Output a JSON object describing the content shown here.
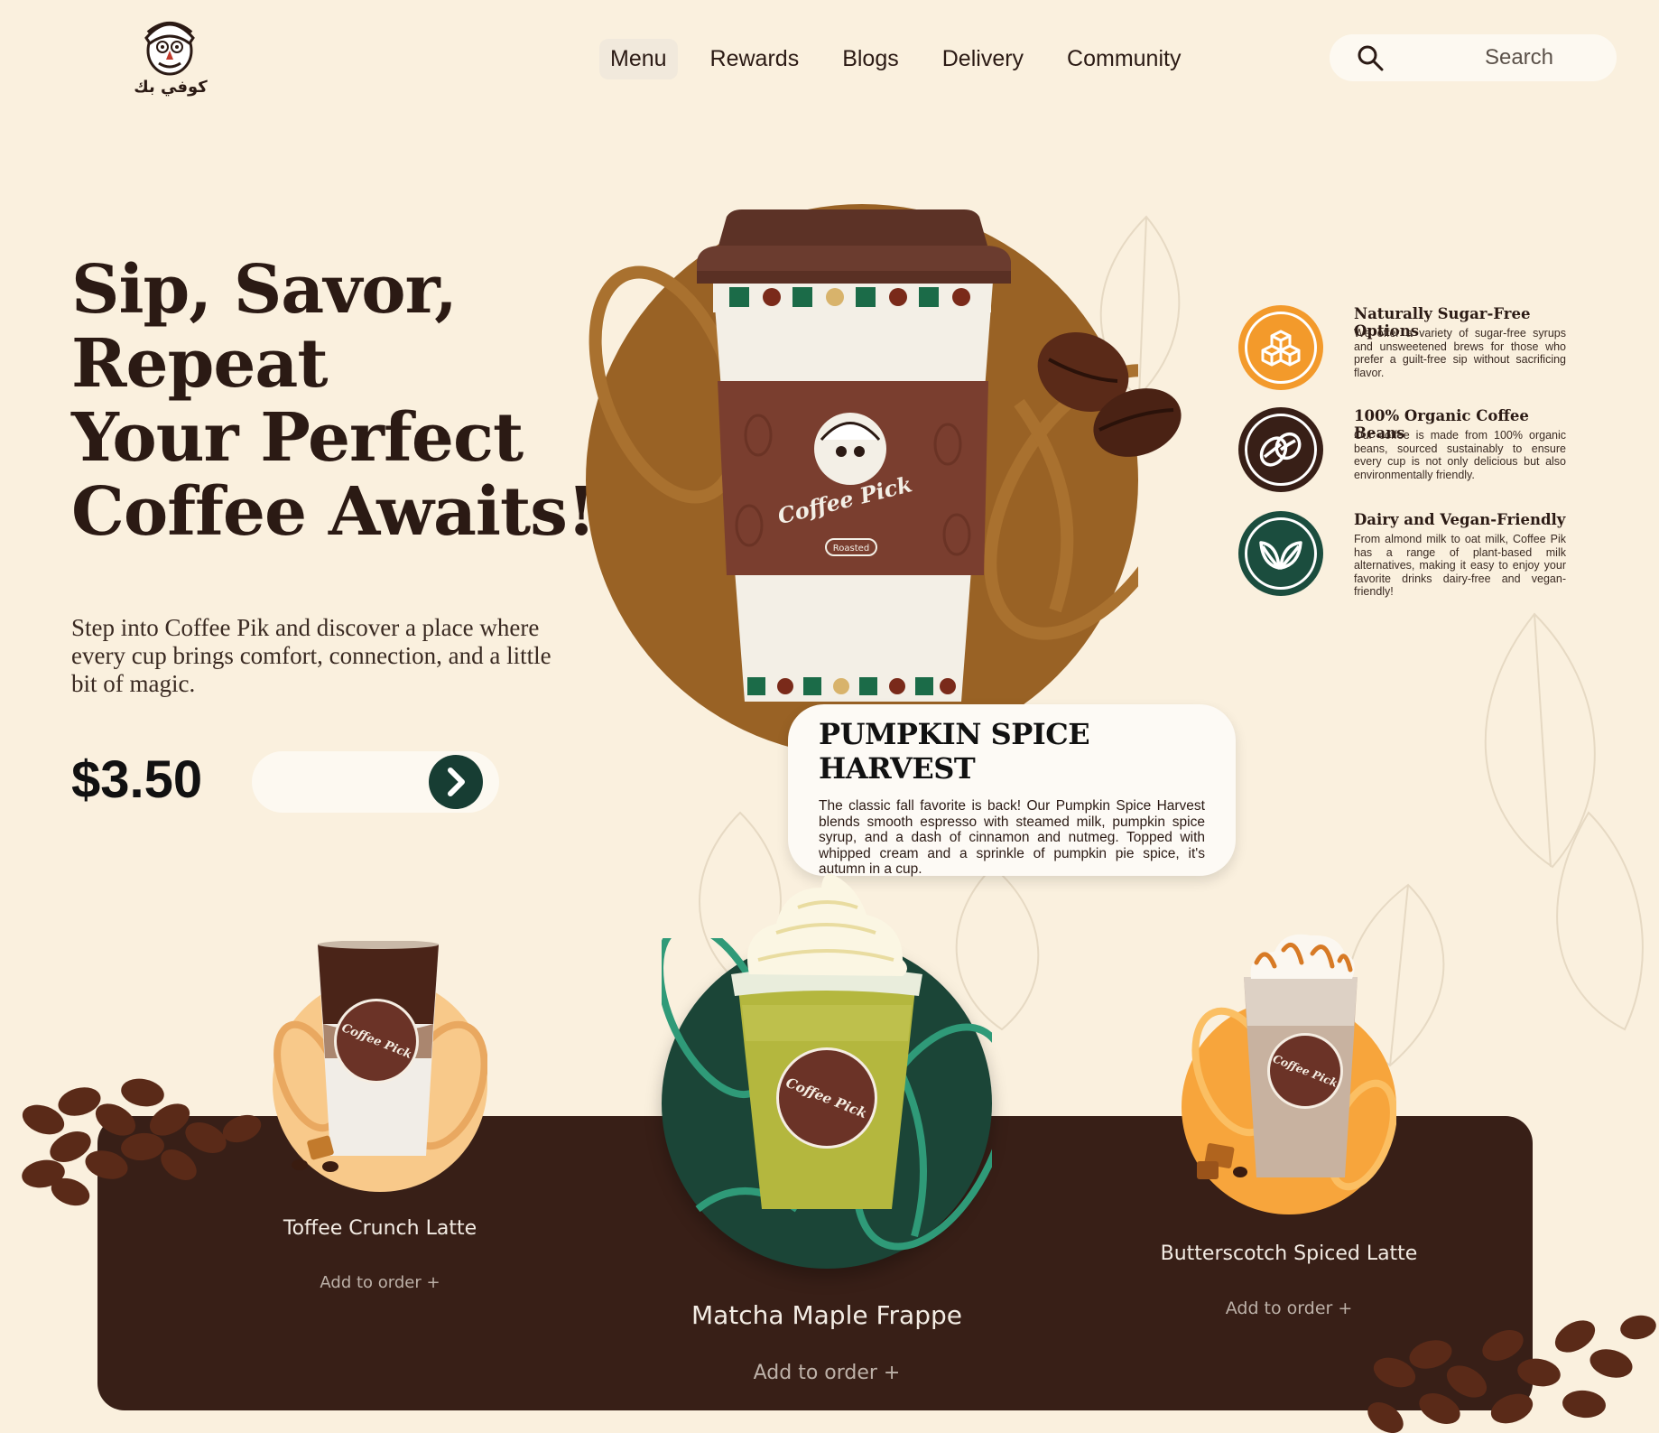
{
  "header": {
    "logo_text": "كوفي بك",
    "nav": [
      {
        "label": "Menu",
        "active": true
      },
      {
        "label": "Rewards",
        "active": false
      },
      {
        "label": "Blogs",
        "active": false
      },
      {
        "label": "Delivery",
        "active": false
      },
      {
        "label": "Community",
        "active": false
      }
    ],
    "search_placeholder": "Search"
  },
  "hero": {
    "title_lines": [
      "Sip, Savor,",
      "Repeat",
      "Your Perfect",
      "Coffee Awaits!"
    ],
    "description": "Step into Coffee Pik and discover a place where every cup brings comfort, connection, and a little bit of magic.",
    "price": "$3.50",
    "go_icon": "chevron-right-icon"
  },
  "featured": {
    "cup_brand": "Coffee Pick",
    "cup_sub": "Roasted",
    "name": "PUMPKIN SPICE HARVEST",
    "description": "The classic fall favorite is back! Our Pumpkin Spice Harvest blends smooth espresso with steamed milk, pumpkin spice syrup, and a dash of cinnamon and nutmeg. Topped with whipped cream and a sprinkle of pumpkin pie spice, it's autumn in a cup."
  },
  "features": [
    {
      "icon": "sugar-cubes-icon",
      "color": "#f39a2b",
      "title": "Naturally Sugar-Free Options",
      "text": "We offer a variety of sugar-free syrups and unsweetened brews for those who prefer a guilt-free sip without sacrificing flavor."
    },
    {
      "icon": "coffee-beans-icon",
      "color": "#381f17",
      "title": "100% Organic Coffee Beans",
      "text": "Our coffee is made from 100% organic beans, sourced sustainably to ensure every cup is not only delicious but also environmentally friendly."
    },
    {
      "icon": "leaves-icon",
      "color": "#1b4d3e",
      "title": "Dairy and Vegan-Friendly",
      "text": "From almond milk to oat milk, Coffee Pik has a range of plant-based milk alternatives, making it easy to enjoy your favorite drinks dairy-free and vegan-friendly!"
    }
  ],
  "products": [
    {
      "name": "Toffee Crunch Latte",
      "add": "Add to order +",
      "color": "#f8c98a"
    },
    {
      "name": "Matcha Maple Frappe",
      "add": "Add to order +",
      "color": "#1b4537"
    },
    {
      "name": "Butterscotch Spiced Latte",
      "add": "Add to order +",
      "color": "#f7a53c"
    }
  ],
  "badge_text": "Coffee Pick",
  "colors": {
    "background": "#faf0de",
    "panel": "#381f17",
    "accent_green": "#173d33",
    "accent_orange": "#f39a2b",
    "brown": "#996225"
  }
}
